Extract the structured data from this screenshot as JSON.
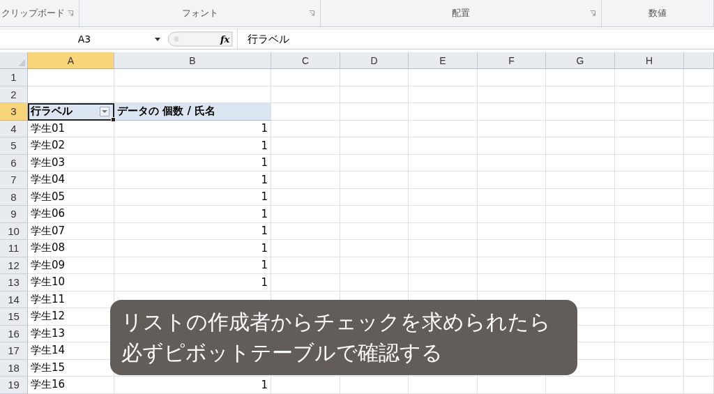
{
  "ribbon_groups": [
    {
      "label": "クリップボード",
      "launcher": true
    },
    {
      "label": "フォント",
      "launcher": true
    },
    {
      "label": "配置",
      "launcher": true
    },
    {
      "label": "数値",
      "launcher": false
    }
  ],
  "formula_bar": {
    "name_box": "A3",
    "function_label": "fx",
    "formula": "行ラベル"
  },
  "columns": [
    {
      "label": "A",
      "selected": true
    },
    {
      "label": "B",
      "selected": false
    },
    {
      "label": "C",
      "selected": false
    },
    {
      "label": "D",
      "selected": false
    },
    {
      "label": "E",
      "selected": false
    },
    {
      "label": "F",
      "selected": false
    },
    {
      "label": "G",
      "selected": false
    },
    {
      "label": "H",
      "selected": false
    }
  ],
  "rows": [
    {
      "number": "1",
      "selected": false,
      "kind": "empty"
    },
    {
      "number": "2",
      "selected": false,
      "kind": "empty"
    },
    {
      "number": "3",
      "selected": true,
      "kind": "header",
      "label": "行ラベル",
      "value": "データの 個数 / 氏名"
    },
    {
      "number": "4",
      "selected": false,
      "kind": "data",
      "label": "学生01",
      "value": "1"
    },
    {
      "number": "5",
      "selected": false,
      "kind": "data",
      "label": "学生02",
      "value": "1"
    },
    {
      "number": "6",
      "selected": false,
      "kind": "data",
      "label": "学生03",
      "value": "1"
    },
    {
      "number": "7",
      "selected": false,
      "kind": "data",
      "label": "学生04",
      "value": "1"
    },
    {
      "number": "8",
      "selected": false,
      "kind": "data",
      "label": "学生05",
      "value": "1"
    },
    {
      "number": "9",
      "selected": false,
      "kind": "data",
      "label": "学生06",
      "value": "1"
    },
    {
      "number": "10",
      "selected": false,
      "kind": "data",
      "label": "学生07",
      "value": "1"
    },
    {
      "number": "11",
      "selected": false,
      "kind": "data",
      "label": "学生08",
      "value": "1"
    },
    {
      "number": "12",
      "selected": false,
      "kind": "data",
      "label": "学生09",
      "value": "1"
    },
    {
      "number": "13",
      "selected": false,
      "kind": "data",
      "label": "学生10",
      "value": "1"
    },
    {
      "number": "14",
      "selected": false,
      "kind": "data",
      "label": "学生11"
    },
    {
      "number": "15",
      "selected": false,
      "kind": "data",
      "label": "学生12"
    },
    {
      "number": "16",
      "selected": false,
      "kind": "data",
      "label": "学生13"
    },
    {
      "number": "17",
      "selected": false,
      "kind": "data",
      "label": "学生14"
    },
    {
      "number": "18",
      "selected": false,
      "kind": "data",
      "label": "学生15"
    },
    {
      "number": "19",
      "selected": false,
      "kind": "data",
      "label": "学生16",
      "value": "1"
    }
  ],
  "caption": {
    "lines": [
      "リストの作成者からチェックを求められたら",
      "必ずピボットテーブルで確認する"
    ]
  }
}
